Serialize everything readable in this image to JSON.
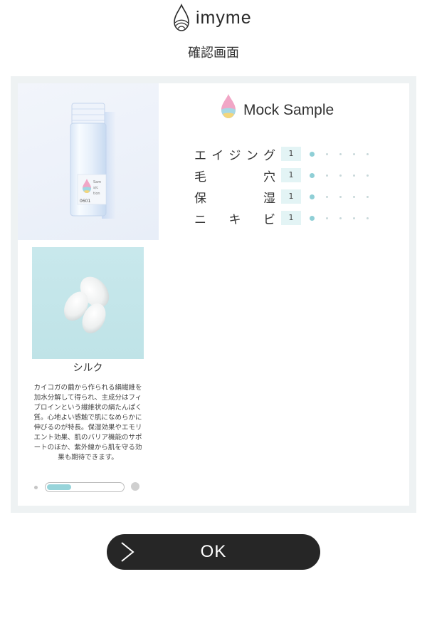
{
  "header": {
    "logo_text": "imyme",
    "page_title": "確認画面"
  },
  "product": {
    "bottle_code": "0601",
    "bottle_label_text": [
      "Sam",
      "s/c",
      "tion"
    ]
  },
  "ingredient": {
    "name": "シルク",
    "description": "カイコガの繭から作られる絹繊維を加水分解して得られ、主成分はフィブロインという繊維状の絹たんぱく質。心地よい感触で肌になめらかに伸びるのが特長。保湿効果やエモリエント効果、肌のバリア機能のサポートのほか、紫外線から肌を守る効果も期待できます。",
    "slider_progress": 0.33
  },
  "sample": {
    "name": "Mock Sample",
    "metrics": [
      {
        "label_chars": [
          "エ",
          "イ",
          "ジ",
          "ン",
          "グ"
        ],
        "value": "1",
        "level": 1,
        "max": 5
      },
      {
        "label_chars": [
          "毛",
          "穴"
        ],
        "value": "1",
        "level": 1,
        "max": 5
      },
      {
        "label_chars": [
          "保",
          "湿"
        ],
        "value": "1",
        "level": 1,
        "max": 5
      },
      {
        "label_chars": [
          "ニ",
          "キ",
          "ビ"
        ],
        "value": "1",
        "level": 1,
        "max": 5
      }
    ]
  },
  "actions": {
    "ok_label": "OK"
  },
  "colors": {
    "accent": "#8fcfd6",
    "button_bg": "#262626",
    "panel_bg": "#eef2f3"
  },
  "icons": {
    "logo": "drop-logo-icon",
    "sample": "drop-color-icon",
    "ok": "chevron-right-icon"
  }
}
